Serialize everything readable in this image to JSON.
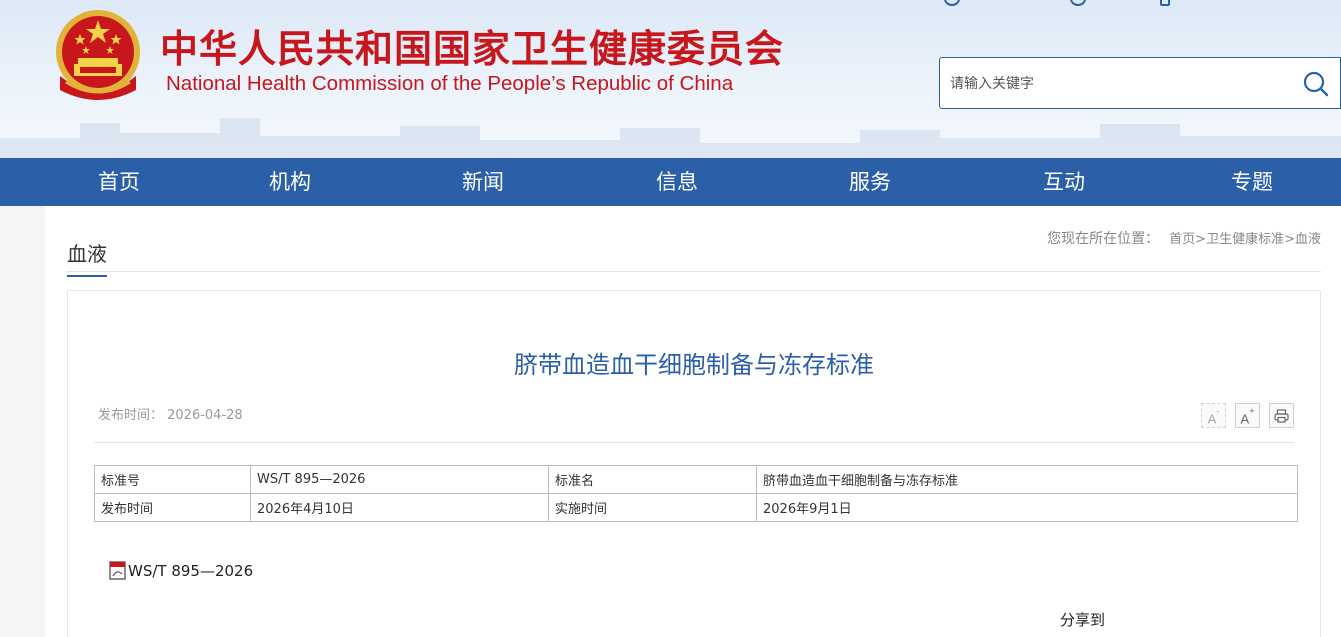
{
  "header": {
    "title_cn": "中华人民共和国国家卫生健康委员会",
    "title_en": "National Health Commission of the People’s  Republic of China",
    "search_placeholder": "请输入关键字"
  },
  "nav": {
    "items": [
      {
        "label": "首页"
      },
      {
        "label": "机构"
      },
      {
        "label": "新闻"
      },
      {
        "label": "信息"
      },
      {
        "label": "服务"
      },
      {
        "label": "互动"
      },
      {
        "label": "专题"
      }
    ]
  },
  "category": {
    "title": "血液"
  },
  "breadcrumb": {
    "label": "您现在所在位置：",
    "items": [
      "首页",
      "卫生健康标准",
      "血液"
    ],
    "separator": ">"
  },
  "article": {
    "title": "脐带血造血干细胞制备与冻存标准",
    "pubdate": "发布时间：  2026-04-28",
    "tools": {
      "font_smaller": "A-",
      "font_larger": "A+",
      "print_icon": "printer-icon"
    },
    "table": {
      "rows": [
        [
          "标准号",
          "WS/T 895—2026",
          "标准名",
          "脐带血造血干细胞制备与冻存标准"
        ],
        [
          "发布时间",
          "2026年4月10日",
          "实施时间",
          "2026年9月1日"
        ]
      ]
    },
    "attachment": "WS/T 895—2026",
    "share_label": "分享到"
  },
  "colors": {
    "brand_red": "#c8161d",
    "brand_blue": "#2b5fa8"
  }
}
